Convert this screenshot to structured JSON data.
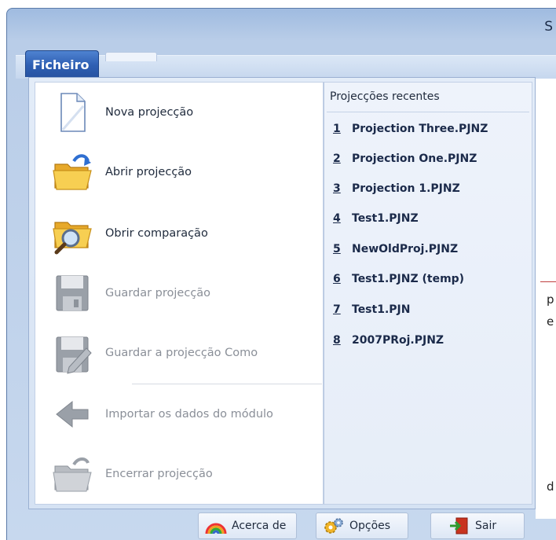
{
  "window": {
    "title_fragment": "S"
  },
  "tabs": {
    "file_tab_label": "Ficheiro"
  },
  "commands": [
    {
      "label": "Nova projecção",
      "icon": "new-document-icon",
      "enabled": true
    },
    {
      "label": "Abrir projecção",
      "icon": "open-folder-icon",
      "enabled": true
    },
    {
      "label": "Obrir comparação",
      "icon": "folder-magnifier-icon",
      "enabled": true
    },
    {
      "label": "Guardar projecção",
      "icon": "floppy-disk-icon",
      "enabled": false
    },
    {
      "label": "Guardar a projecção Como",
      "icon": "save-as-icon",
      "enabled": false
    },
    {
      "label": "Importar os dados do módulo",
      "icon": "import-arrow-icon",
      "enabled": false
    },
    {
      "label": "Encerrar projecção",
      "icon": "close-project-icon",
      "enabled": false
    }
  ],
  "recent": {
    "title": "Projecções recentes",
    "items": [
      {
        "num": "1",
        "name": "Projection Three.PJNZ"
      },
      {
        "num": "2",
        "name": "Projection One.PJNZ"
      },
      {
        "num": "3",
        "name": "Projection 1.PJNZ"
      },
      {
        "num": "4",
        "name": "Test1.PJNZ"
      },
      {
        "num": "5",
        "name": "NewOldProj.PJNZ"
      },
      {
        "num": "6",
        "name": "Test1.PJNZ (temp)"
      },
      {
        "num": "7",
        "name": "Test1.PJN"
      },
      {
        "num": "8",
        "name": "2007PRoj.PJNZ"
      }
    ]
  },
  "bottom": {
    "about_label": "Acerca de",
    "options_label": "Opções",
    "exit_label": "Sair"
  },
  "background_text": {
    "a": "p",
    "b": "e",
    "c": "d"
  }
}
